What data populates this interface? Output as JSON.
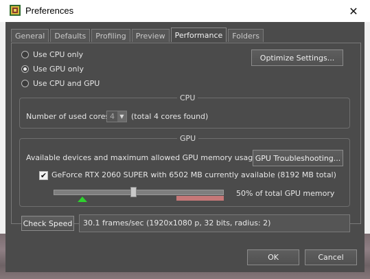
{
  "window": {
    "title": "Preferences"
  },
  "tabs": [
    "General",
    "Defaults",
    "Profiling",
    "Preview",
    "Performance",
    "Folders"
  ],
  "active_tab": "Performance",
  "processing": {
    "options": [
      "Use CPU only",
      "Use GPU only",
      "Use CPU and GPU"
    ],
    "selected": "Use GPU only"
  },
  "buttons": {
    "optimize": "Optimize Settings...",
    "gpu_troubleshooting": "GPU Troubleshooting...",
    "check_speed": "Check Speed",
    "ok": "OK",
    "cancel": "Cancel"
  },
  "cpu": {
    "group_label": "CPU",
    "cores_label": "Number of used cores:",
    "cores_value": "4",
    "cores_total": "(total 4 cores found)"
  },
  "gpu": {
    "group_label": "GPU",
    "devices_label": "Available devices and maximum allowed GPU memory usage:",
    "device": "GeForce RTX 2060 SUPER with 6502 MB currently available (8192 MB total)",
    "device_checked": true,
    "memory_percent": 50,
    "memory_text": "50%  of total GPU memory"
  },
  "speed_result": "30.1 frames/sec (1920x1080 p, 32 bits, radius: 2)",
  "icons": {
    "app": "preferences-app-icon",
    "close": "close-icon",
    "spin": "chevron-down-icon",
    "check": "check-icon",
    "marker": "triangle-up-icon"
  }
}
